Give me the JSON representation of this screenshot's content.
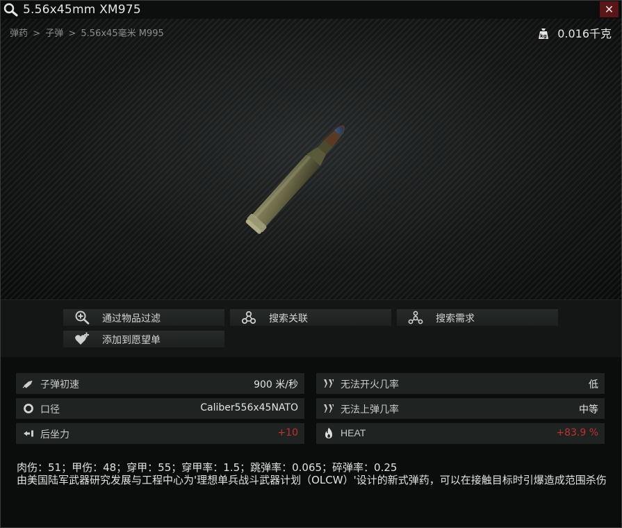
{
  "window": {
    "title": "5.56x45mm XM975",
    "close_label": "✕"
  },
  "breadcrumb": {
    "items": [
      "弹药",
      "子弹",
      "5.56x45毫米 M995"
    ],
    "separator": ">"
  },
  "weight": {
    "value": "0.016千克",
    "icon": "weight-bag-icon"
  },
  "actions": {
    "filter_by_item": "通过物品过滤",
    "search_linked": "搜索关联",
    "search_required": "搜索需求",
    "add_to_wishlist": "添加到愿望单"
  },
  "stats": {
    "left": [
      {
        "label": "子弹初速",
        "value": "900 米/秒",
        "icon": "bullet-speed-icon"
      },
      {
        "label": "口径",
        "value": "Caliber556x45NATO",
        "icon": "caliber-ring-icon"
      },
      {
        "label": "后坐力",
        "value": "+10",
        "icon": "recoil-icon",
        "value_color": "#c3302a"
      }
    ],
    "right": [
      {
        "label": "无法开火几率",
        "value": "低",
        "icon": "misfire-icon"
      },
      {
        "label": "无法上弹几率",
        "value": "中等",
        "icon": "misfeed-icon"
      },
      {
        "label": "HEAT",
        "value": "+83.9 %",
        "icon": "flame-icon",
        "value_color": "#c3302a"
      }
    ]
  },
  "damage_line": "肉伤：51；甲伤：48；穿甲：55；穿甲率：1.5；跳弹率：0.065；碎弹率：0.25",
  "description": "由美国陆军武器研究发展与工程中心为'理想单兵战斗武器计划（OLCW）'设计的新式弹药，可以在接触目标时引爆造成范围杀伤",
  "colors": {
    "accent_red": "#c3302a",
    "close_bg": "#5a1616",
    "panel_bg": "#1f2322"
  }
}
